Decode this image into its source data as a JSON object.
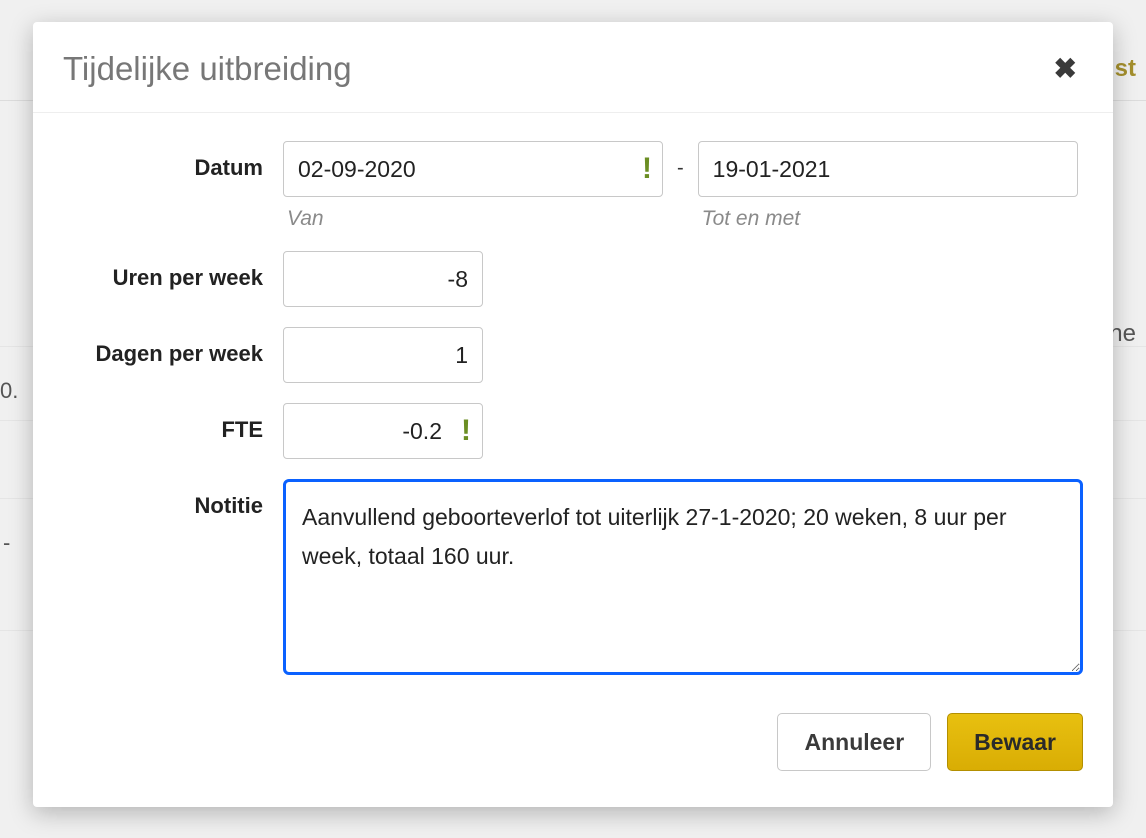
{
  "background": {
    "crumb_right_top": "st",
    "crumb_right_mid": "ne",
    "left_value": "0.",
    "dash": "-"
  },
  "modal": {
    "title": "Tijdelijke uitbreiding",
    "close_glyph": "✖",
    "labels": {
      "date": "Datum",
      "hours": "Uren per week",
      "days": "Dagen per week",
      "fte": "FTE",
      "note": "Notitie"
    },
    "hints": {
      "from": "Van",
      "to": "Tot en met"
    },
    "values": {
      "date_from": "02-09-2020",
      "date_to": "19-01-2021",
      "hours": "-8",
      "days": "1",
      "fte": "-0.2",
      "note": "Aanvullend geboorteverlof tot uiterlijk 27-1-2020; 20 weken, 8 uur per week, totaal 160 uur. "
    },
    "date_separator": "-",
    "warning_glyph": "!"
  },
  "buttons": {
    "cancel": "Annuleer",
    "save": "Bewaar"
  }
}
